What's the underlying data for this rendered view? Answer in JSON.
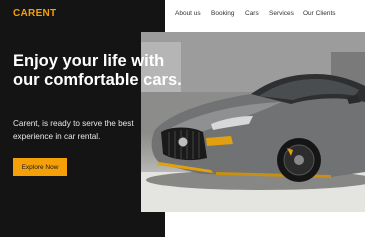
{
  "brand": {
    "logo_text": "CARENT",
    "accent_color": "#f5a009"
  },
  "nav": {
    "items": [
      {
        "label": "About us"
      },
      {
        "label": "Booking"
      },
      {
        "label": "Cars"
      },
      {
        "label": "Services"
      },
      {
        "label": "Our Clients"
      }
    ]
  },
  "hero": {
    "headline": "Enjoy your life with our comfortable cars.",
    "subtext": "Carent, is ready to serve the best experience in car rental.",
    "cta_label": "Explore Now",
    "image": "sports-car-photo"
  },
  "colors": {
    "dark_panel": "#141414",
    "background": "#ffffff"
  }
}
